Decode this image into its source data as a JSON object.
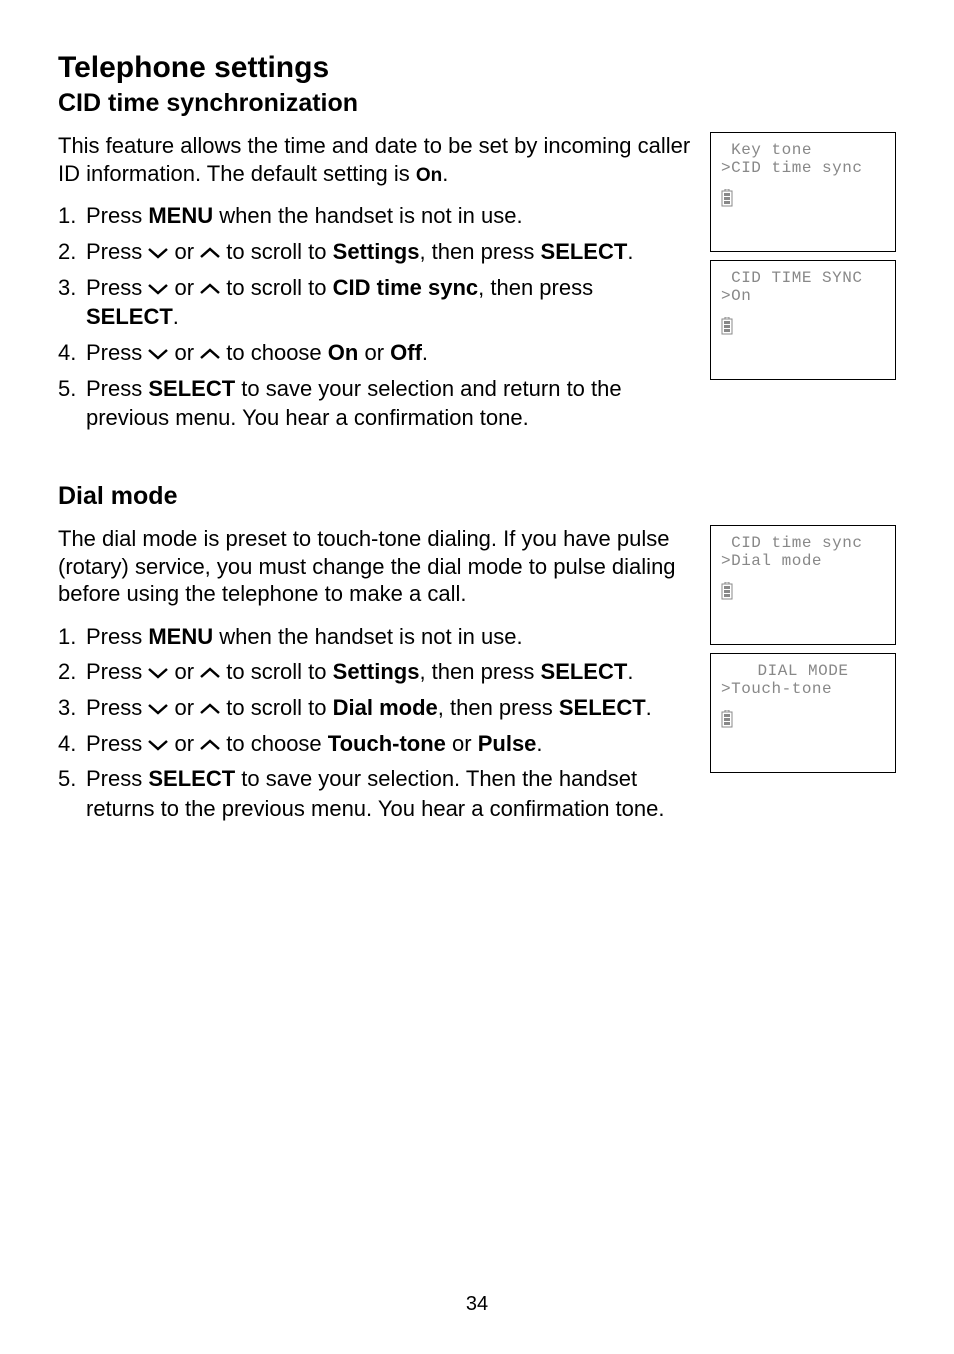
{
  "pageNumber": "34",
  "title": "Telephone settings",
  "section1": {
    "heading": "CID time synchronization",
    "intro_prefix": "This feature allows the time and date to be set by incoming caller ID information. The default setting is ",
    "intro_strong": "On",
    "intro_suffix": ".",
    "steps": {
      "s1": {
        "pre": "Press ",
        "b1": "MENU",
        "post": " when the handset is not in use."
      },
      "s2": {
        "pre": "Press ",
        "mid": " or ",
        "mid2": " to scroll to ",
        "b1": "Settings",
        "post1": ", then press ",
        "b2": "SELECT",
        "post2": "."
      },
      "s3": {
        "pre": "Press ",
        "mid": " or ",
        "mid2": " to scroll to ",
        "b1": "CID time sync",
        "post1": ", then press ",
        "b2": "SELECT",
        "post2": "."
      },
      "s4": {
        "pre": "Press ",
        "mid": " or ",
        "mid2": " to choose ",
        "b1": "On",
        "or": " or ",
        "b2": "Off",
        "post": "."
      },
      "s5": {
        "pre": "Press ",
        "b1": "SELECT",
        "post": " to save your selection and return to the previous menu. You hear a confirmation tone."
      }
    }
  },
  "section2": {
    "heading": "Dial mode",
    "intro": "The dial mode is preset to touch-tone dialing. If you have pulse (rotary) service, you must change the dial mode to pulse dialing before using the telephone to make a call.",
    "steps": {
      "s1": {
        "pre": "Press ",
        "b1": "MENU",
        "post": " when the handset is not in use."
      },
      "s2": {
        "pre": "Press ",
        "mid": " or ",
        "mid2": " to scroll to ",
        "b1": "Settings",
        "post1": ", then press ",
        "b2": "SELECT",
        "post2": "."
      },
      "s3": {
        "pre": "Press ",
        "mid": " or ",
        "mid2": " to scroll to ",
        "b1": "Dial mode",
        "post1": ", then press ",
        "b2": "SELECT",
        "post2": "."
      },
      "s4": {
        "pre": "Press ",
        "mid": " or ",
        "mid2": " to choose ",
        "b1": "Touch-tone",
        "or": " or ",
        "b2": "Pulse",
        "post": "."
      },
      "s5": {
        "pre": "Press ",
        "b1": "SELECT",
        "post": " to save your selection. Then the handset returns to the previous menu. You hear a confirmation tone."
      }
    }
  },
  "lcd": {
    "screen1": {
      "line1": " Key tone",
      "line2": ">CID time sync"
    },
    "screen2": {
      "line1": " CID TIME SYNC",
      "line2": ">On"
    },
    "screen3": {
      "line1": " CID time sync",
      "line2": ">Dial mode"
    },
    "screen4": {
      "line1": "DIAL MODE",
      "line2": ">Touch-tone"
    }
  }
}
